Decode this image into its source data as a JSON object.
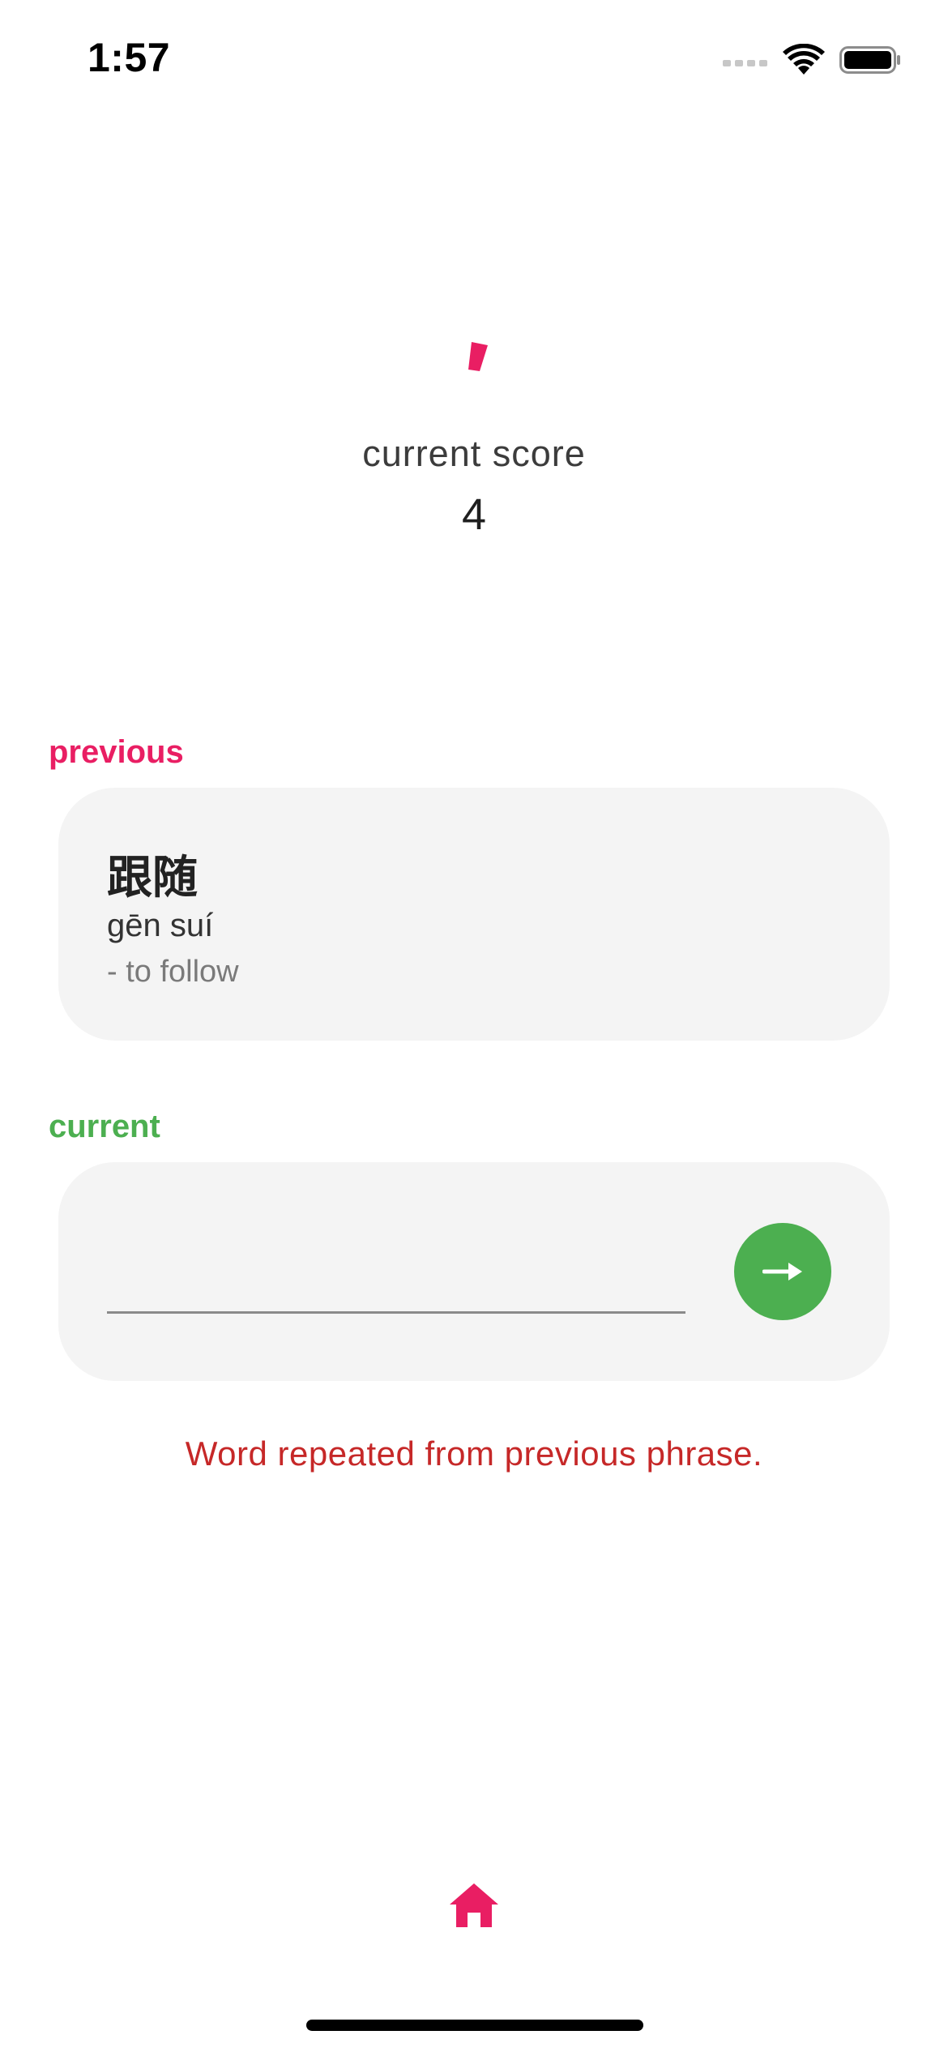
{
  "status_bar": {
    "time": "1:57"
  },
  "score": {
    "label": "current score",
    "value": "4",
    "accent_color": "#e91e63"
  },
  "previous": {
    "label": "previous",
    "hanzi": "跟随",
    "pinyin": "gēn suí",
    "meaning": "- to follow"
  },
  "current": {
    "label": "current",
    "input_value": "",
    "input_placeholder": "",
    "submit_icon": "arrow-right-icon"
  },
  "error_message": "Word repeated from previous phrase.",
  "bottom_nav": {
    "home_icon": "home-icon"
  },
  "colors": {
    "primary": "#e91e63",
    "success": "#4caf50",
    "error": "#c62828",
    "card_background": "#f4f4f4"
  }
}
